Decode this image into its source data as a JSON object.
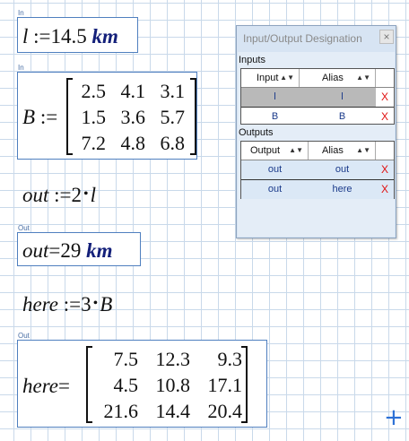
{
  "worksheet": {
    "regions": [
      {
        "tag": "In",
        "var": "l",
        "op": ":=",
        "value": "14.5",
        "unit": "km"
      },
      {
        "tag": "In",
        "var": "B",
        "op": ":=",
        "matrix": [
          [
            "2.5",
            "4.1",
            "3.1"
          ],
          [
            "1.5",
            "3.6",
            "5.7"
          ],
          [
            "7.2",
            "4.8",
            "6.8"
          ]
        ]
      },
      {
        "var": "out",
        "op": ":=",
        "coef": "2",
        "dot": "•",
        "ref": "l"
      },
      {
        "tag": "Out",
        "var": "out",
        "op": "=",
        "value": "29",
        "unit": "km"
      },
      {
        "var": "here",
        "op": ":=",
        "coef": "3",
        "dot": "•",
        "ref": "B"
      },
      {
        "tag": "Out",
        "var": "here",
        "op": "=",
        "matrix": [
          [
            "7.5",
            "12.3",
            "9.3"
          ],
          [
            "4.5",
            "10.8",
            "17.1"
          ],
          [
            "21.6",
            "14.4",
            "20.4"
          ]
        ]
      }
    ]
  },
  "dialog": {
    "title": "Input/Output Designation",
    "close": "×",
    "inputs_label": "Inputs",
    "outputs_label": "Outputs",
    "inputs_headers": [
      "Input",
      "Alias"
    ],
    "outputs_headers": [
      "Output",
      "Alias"
    ],
    "inputs": [
      {
        "name": "l",
        "alias": "l",
        "remove": "X"
      },
      {
        "name": "B",
        "alias": "B",
        "remove": "X"
      }
    ],
    "outputs": [
      {
        "name": "out",
        "alias": "out",
        "remove": "X"
      },
      {
        "name": "out",
        "alias": "here",
        "remove": "X"
      }
    ],
    "sort_glyph": "▲▼"
  },
  "add_icon": "+",
  "colors": {
    "accent": "#2a6fd6",
    "unit": "#14207a",
    "remove": "#e01010",
    "border": "#4f7fbf"
  }
}
